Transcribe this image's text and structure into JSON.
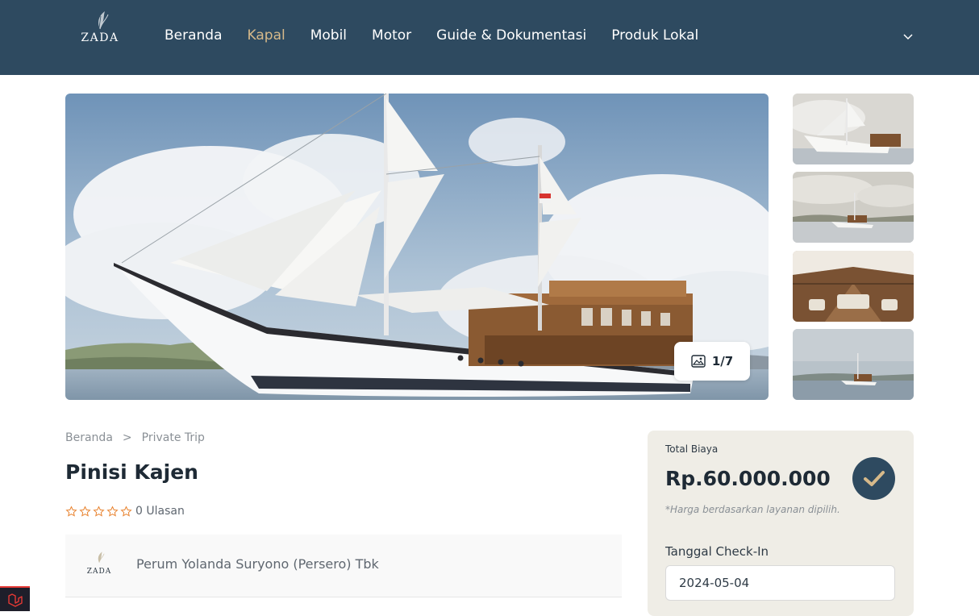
{
  "brand": {
    "logo_text": "ZADA"
  },
  "nav": {
    "items": [
      {
        "label": "Beranda"
      },
      {
        "label": "Kapal"
      },
      {
        "label": "Mobil"
      },
      {
        "label": "Motor"
      },
      {
        "label": "Guide & Dokumentasi"
      },
      {
        "label": "Produk Lokal"
      }
    ],
    "active": "Kapal",
    "menu_icon": "chevron-down-icon"
  },
  "gallery": {
    "counter": "1/7",
    "counter_icon": "image-icon",
    "thumbnail_count": 4
  },
  "breadcrumb": {
    "items": [
      {
        "label": "Beranda"
      },
      {
        "label": "Private Trip"
      }
    ],
    "separator": ">"
  },
  "product": {
    "title": "Pinisi Kajen",
    "rating": 0,
    "rating_max": 5,
    "reviews_label": "0 Ulasan"
  },
  "vendor": {
    "logo_text": "ZADA",
    "name": "Perum Yolanda Suryono (Persero) Tbk"
  },
  "pricing": {
    "label": "Total Biaya",
    "value": "Rp.60.000.000",
    "note": "*Harga berdasarkan layanan dipilih.",
    "checkin_label": "Tanggal Check-In",
    "checkin_value": "2024-05-04"
  },
  "colors": {
    "header_bg": "#2e4a60",
    "nav_active": "#d6b98a",
    "star_outline": "#e8822e",
    "price_box_bg": "#efede6"
  }
}
